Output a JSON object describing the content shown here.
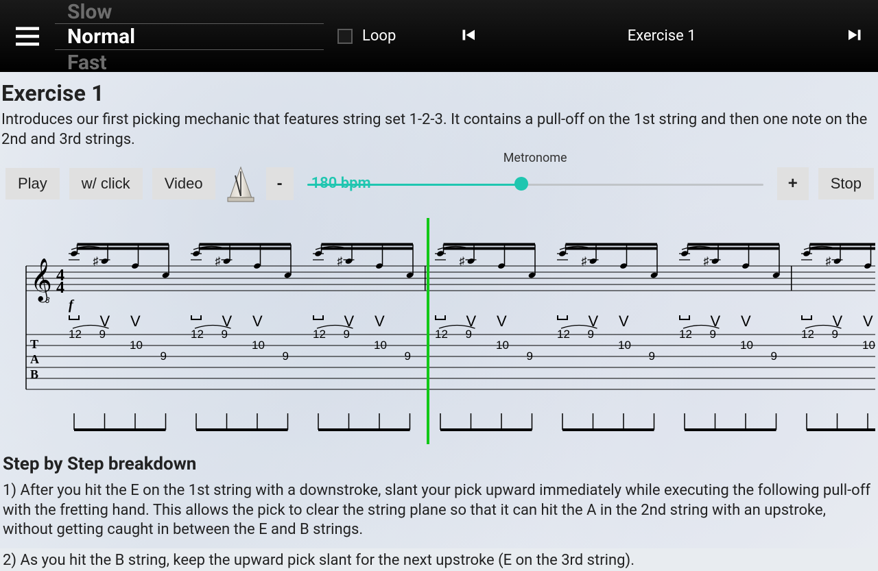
{
  "header": {
    "speeds": {
      "slow": "Slow",
      "normal": "Normal",
      "fast": "Fast"
    },
    "loop_label": "Loop",
    "loop_checked": false,
    "title": "Exercise 1"
  },
  "exercise": {
    "title": "Exercise 1",
    "description": "Introduces our first picking mechanic that features string set 1-2-3. It contains a pull-off on the 1st string and then one note on the 2nd and 3rd strings."
  },
  "controls": {
    "play": "Play",
    "wclick": "w/ click",
    "video": "Video",
    "minus": "-",
    "plus": "+",
    "stop": "Stop",
    "metronome_label": "Metronome",
    "bpm_value": 180,
    "bpm_display": "180 bpm",
    "bpm_min": 40,
    "bpm_max": 340,
    "slider_percent": 47
  },
  "score": {
    "time_signature": "4/4",
    "dynamic": "f",
    "clef": "treble_8vb",
    "tab_letters": [
      "T",
      "A",
      "B"
    ],
    "pattern": {
      "strokes": [
        "down",
        "up",
        "up",
        "down",
        "up",
        "up",
        "down",
        "up",
        "up",
        "down",
        "up",
        "up"
      ],
      "pull_off_between": [
        0,
        1
      ],
      "tab": [
        {
          "string": 1,
          "fret": 12
        },
        {
          "string": 1,
          "fret": 9
        },
        {
          "string": 2,
          "fret": 10
        },
        {
          "string": 3,
          "fret": 9
        }
      ],
      "repeats": 7
    }
  },
  "breakdown": {
    "heading": "Step by Step breakdown",
    "steps": [
      "1) After you hit the E on the 1st string with a downstroke, slant your pick upward immediately while executing the following pull-off with the fretting hand. This allows the pick to clear the string plane so that it can hit the A in the 2nd string with an upstroke, without getting caught in between the E and B strings.",
      " 2) As you hit the B string, keep the upward pick slant for the next upstroke (E on the 3rd string)."
    ]
  },
  "icons": {
    "menu": "menu-icon",
    "prev": "skip-previous-icon",
    "next": "skip-next-icon",
    "metronome": "metronome-icon"
  }
}
